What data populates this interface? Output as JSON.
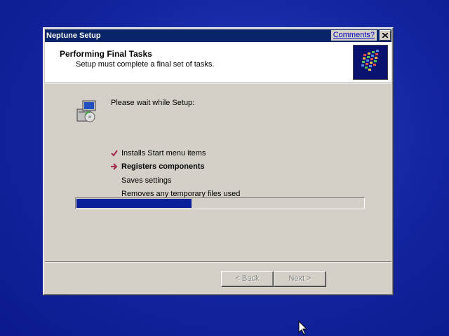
{
  "window": {
    "title": "Neptune Setup",
    "comments_link": "Comments?",
    "close_icon": "close-icon"
  },
  "header": {
    "title": "Performing Final Tasks",
    "subtitle": "Setup must complete a final set of tasks.",
    "icon": "setup-logo-icon"
  },
  "content": {
    "intro": "Please wait while Setup:",
    "tasks": [
      {
        "label": "Installs Start menu items",
        "status": "done",
        "icon": "checkmark-icon"
      },
      {
        "label": "Registers components",
        "status": "current",
        "icon": "arrow-right-icon"
      },
      {
        "label": "Saves settings",
        "status": "pending"
      },
      {
        "label": "Removes any temporary files used",
        "status": "pending"
      }
    ],
    "progress_fraction": 0.4
  },
  "buttons": {
    "back_label": "< Back",
    "next_label": "Next >"
  },
  "colors": {
    "desktop": "#13249f",
    "titlebar": "#0a246a",
    "progress": "#0a1e9a",
    "check_mark": "#a0284c"
  }
}
